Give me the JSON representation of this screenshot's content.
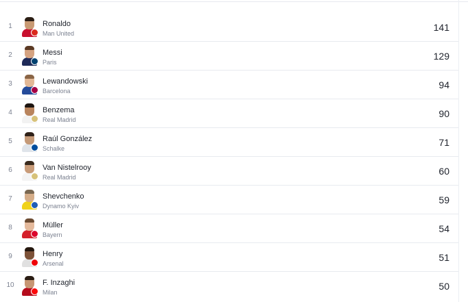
{
  "players": [
    {
      "rank": "1",
      "name": "Ronaldo",
      "club": "Man United",
      "goals": "141",
      "skin": "#c99a73",
      "hair": "#2b1d14",
      "shirt": "#c8102e",
      "crest": "#da291c"
    },
    {
      "rank": "2",
      "name": "Messi",
      "club": "Paris",
      "goals": "129",
      "skin": "#d5a381",
      "hair": "#5b3a24",
      "shirt": "#1e2a58",
      "crest": "#004170"
    },
    {
      "rank": "3",
      "name": "Lewandowski",
      "club": "Barcelona",
      "goals": "94",
      "skin": "#e2b896",
      "hair": "#8a6546",
      "shirt": "#244b9a",
      "crest": "#a50044"
    },
    {
      "rank": "4",
      "name": "Benzema",
      "club": "Real Madrid",
      "goals": "90",
      "skin": "#b9845d",
      "hair": "#1d1510",
      "shirt": "#f2f2f2",
      "crest": "#d7c27a"
    },
    {
      "rank": "5",
      "name": "Raúl González",
      "club": "Schalke",
      "goals": "71",
      "skin": "#c59a78",
      "hair": "#2f2118",
      "shirt": "#dfe4ea",
      "crest": "#004d9d"
    },
    {
      "rank": "6",
      "name": "Van Nistelrooy",
      "club": "Real Madrid",
      "goals": "60",
      "skin": "#c99c79",
      "hair": "#3a2a1d",
      "shirt": "#f4f4f4",
      "crest": "#d7c27a"
    },
    {
      "rank": "7",
      "name": "Shevchenko",
      "club": "Dynamo Kyiv",
      "goals": "59",
      "skin": "#d5ad88",
      "hair": "#7a6851",
      "shirt": "#f0d21a",
      "crest": "#1f5eb8"
    },
    {
      "rank": "8",
      "name": "Müller",
      "club": "Bayern",
      "goals": "54",
      "skin": "#e4b99b",
      "hair": "#6b4b32",
      "shirt": "#d4202b",
      "crest": "#dc052d"
    },
    {
      "rank": "9",
      "name": "Henry",
      "club": "Arsenal",
      "goals": "51",
      "skin": "#7d5238",
      "hair": "#24170f",
      "shirt": "#e0e0e0",
      "crest": "#ef0107"
    },
    {
      "rank": "10",
      "name": "F. Inzaghi",
      "club": "Milan",
      "goals": "50",
      "skin": "#c79673",
      "hair": "#2b1d14",
      "shirt": "#b50c1c",
      "crest": "#fb090b"
    }
  ]
}
